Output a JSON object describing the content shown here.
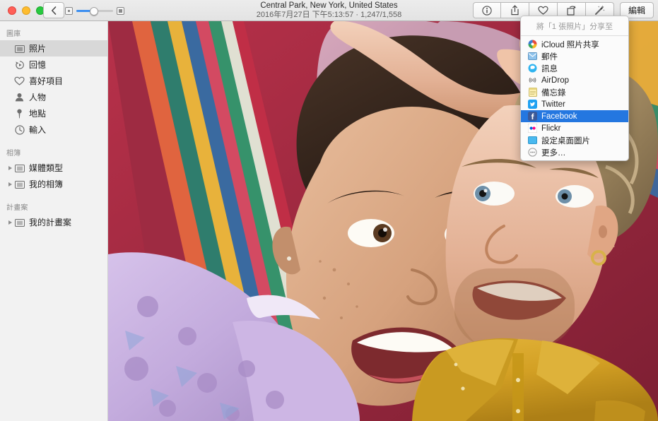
{
  "window": {
    "traffic_lights": [
      "close",
      "minimize",
      "zoom"
    ],
    "title": "Central Park, New York, United States",
    "subtitle": "2016年7月27日 下午5:13:57 · 1,247/1,558"
  },
  "toolbar": {
    "back_label": "‹",
    "zoom_small_icon": "small-thumbnail-icon",
    "zoom_large_icon": "large-thumbnail-icon",
    "zoom_value": 48,
    "buttons": [
      {
        "name": "info-button",
        "icon": "info-icon"
      },
      {
        "name": "share-button",
        "icon": "share-icon"
      },
      {
        "name": "favorite-button",
        "icon": "heart-icon"
      },
      {
        "name": "rotate-button",
        "icon": "rotate-icon"
      },
      {
        "name": "enhance-button",
        "icon": "magic-wand-icon"
      }
    ],
    "edit_label": "編輯"
  },
  "sidebar": {
    "sections": [
      {
        "header": "圖庫",
        "items": [
          {
            "label": "照片",
            "icon": "photos-icon",
            "selected": true,
            "disclosure": false
          },
          {
            "label": "回憶",
            "icon": "memories-icon",
            "selected": false,
            "disclosure": false
          },
          {
            "label": "喜好項目",
            "icon": "heart-icon",
            "selected": false,
            "disclosure": false
          },
          {
            "label": "人物",
            "icon": "people-icon",
            "selected": false,
            "disclosure": false
          },
          {
            "label": "地點",
            "icon": "places-pin-icon",
            "selected": false,
            "disclosure": false
          },
          {
            "label": "輸入",
            "icon": "imports-clock-icon",
            "selected": false,
            "disclosure": false
          }
        ]
      },
      {
        "header": "相簿",
        "items": [
          {
            "label": "媒體類型",
            "icon": "album-icon",
            "selected": false,
            "disclosure": true
          },
          {
            "label": "我的相簿",
            "icon": "album-icon",
            "selected": false,
            "disclosure": true
          }
        ]
      },
      {
        "header": "計畫案",
        "items": [
          {
            "label": "我的計畫案",
            "icon": "album-icon",
            "selected": false,
            "disclosure": true
          }
        ]
      }
    ]
  },
  "share_popover": {
    "title": "將「1 張照片」分享至",
    "selected": "Facebook",
    "items": [
      {
        "label": "iCloud 照片共享",
        "icon": "icloud-sharing-icon",
        "selected": false
      },
      {
        "label": "郵件",
        "icon": "mail-icon",
        "selected": false
      },
      {
        "label": "訊息",
        "icon": "messages-icon",
        "selected": false
      },
      {
        "label": "AirDrop",
        "icon": "airdrop-icon",
        "selected": false
      },
      {
        "label": "備忘錄",
        "icon": "notes-icon",
        "selected": false
      },
      {
        "label": "Twitter",
        "icon": "twitter-icon",
        "selected": false
      },
      {
        "label": "Facebook",
        "icon": "facebook-icon",
        "selected": true
      },
      {
        "label": "Flickr",
        "icon": "flickr-icon",
        "selected": false
      },
      {
        "label": "設定桌面圖片",
        "icon": "desktop-picture-icon",
        "selected": false
      },
      {
        "label": "更多…",
        "icon": "more-icon",
        "selected": false
      }
    ]
  },
  "photo": {
    "description": "兩人躺在彩色條紋毯子上微笑的照片",
    "colors": {
      "lavender_top": "#c9b3e0",
      "mustard_shirt": "#d8a422",
      "pink_hair": "#c69ab0",
      "blanket_stripes": "#c0304a",
      "skin": "#d9a583"
    }
  },
  "accent_color": "#2477e0"
}
